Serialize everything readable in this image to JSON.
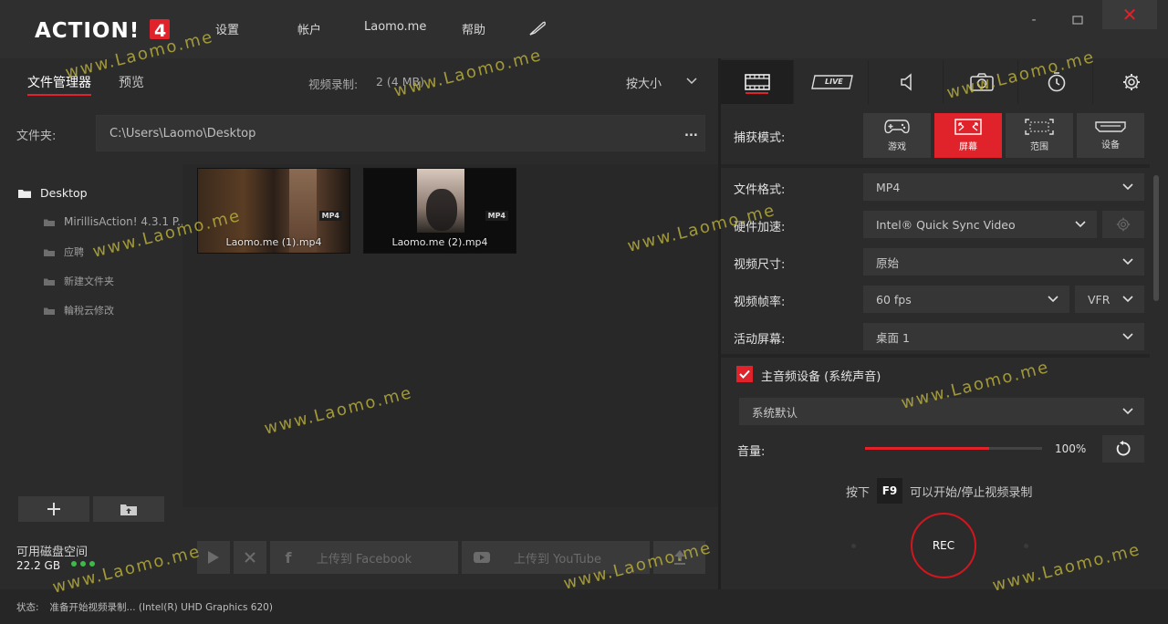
{
  "app": {
    "logo_text": "ACTION! 4",
    "menu": [
      "设置",
      "帐户",
      "Laomo.me",
      "帮助"
    ],
    "window_controls": {
      "minimize": "-",
      "maximize": "□",
      "close": "✕"
    },
    "accent_color": "#e0222a"
  },
  "left": {
    "tabs": [
      {
        "label": "文件管理器",
        "active": true
      },
      {
        "label": "预览",
        "active": false
      }
    ],
    "recording_label": "视频录制:",
    "recording_value": "2 (4 MB)",
    "sort_label": "按大小",
    "folder_label": "文件夹:",
    "folder_path": "C:\\Users\\Laomo\\Desktop",
    "folder_more": "...",
    "tree": {
      "root": "Desktop",
      "children": [
        "MirillisAction! 4.3.1 P...",
        "应聘",
        "新建文件夹",
        "輪稅云修改"
      ]
    },
    "files": [
      {
        "name": "Laomo.me  (1).mp4",
        "format": "MP4"
      },
      {
        "name": "Laomo.me  (2).mp4",
        "format": "MP4"
      }
    ],
    "disk": {
      "label": "可用磁盘空间",
      "value": "22.2 GB"
    },
    "share": {
      "facebook": "上传到 Facebook",
      "youtube": "上传到 YouTube"
    }
  },
  "status": {
    "label": "状态:",
    "text": "准备开始视频录制... (Intel(R) UHD Graphics 620)"
  },
  "right": {
    "tabs": [
      "video-icon",
      "live-icon",
      "audio-icon",
      "camera-icon",
      "timer-icon",
      "gear-icon"
    ],
    "live_text": "LIVE",
    "capture_label": "捕获模式:",
    "capture_modes": [
      {
        "label": "游戏",
        "icon": "gamepad-icon",
        "active": false
      },
      {
        "label": "屏幕",
        "icon": "screen-icon",
        "active": true
      },
      {
        "label": "范围",
        "icon": "region-icon",
        "active": false
      },
      {
        "label": "设备",
        "icon": "device-icon",
        "active": false
      }
    ],
    "settings": {
      "format_label": "文件格式:",
      "format_value": "MP4",
      "hw_label": "硬件加速:",
      "hw_value": "Intel® Quick Sync Video",
      "size_label": "视频尺寸:",
      "size_value": "原始",
      "fps_label": "视频帧率:",
      "fps_value": "60 fps",
      "fps_mode": "VFR",
      "screen_label": "活动屏幕:",
      "screen_value": "桌面 1"
    },
    "audio": {
      "main_label": "主音频设备 (系统声音)",
      "main_checked": true,
      "device_value": "系统默认",
      "volume_label": "音量:",
      "volume_percent": 0.7,
      "volume_text": "100%"
    },
    "hotkey": {
      "prefix": "按下",
      "key": "F9",
      "suffix": "可以开始/停止视频录制"
    },
    "rec_label": "REC"
  },
  "watermarks": [
    "www.Laomo.me",
    "www.Laomo.me",
    "www.Laomo.me",
    "www.Laomo.me",
    "www.Laomo.me",
    "www.Laomo.me",
    "www.Laomo.me",
    "www.Laomo.me",
    "www.Laomo.me",
    "www.Laomo.me",
    "www.Laomo.me",
    "www.Laomo.me"
  ]
}
